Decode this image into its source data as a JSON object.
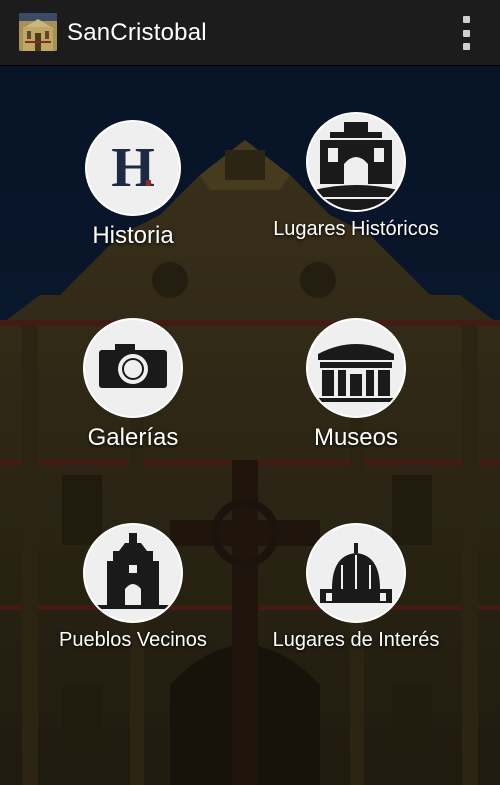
{
  "app_bar": {
    "title": "SanCristobal",
    "app_icon": "cathedral-thumbnail-icon",
    "overflow_icon": "more-vert-icon"
  },
  "menu": [
    {
      "label": "Historia",
      "icon": "letter-h-icon"
    },
    {
      "label": "Lugares Históricos",
      "icon": "historic-arch-icon"
    },
    {
      "label": "Galerías",
      "icon": "camera-icon"
    },
    {
      "label": "Museos",
      "icon": "museum-building-icon"
    },
    {
      "label": "Pueblos Vecinos",
      "icon": "village-church-icon"
    },
    {
      "label": "Lugares de Interés",
      "icon": "dome-icon"
    }
  ],
  "colors": {
    "app_bar": "#1c1c1c",
    "sky": "#0e2340",
    "facade": "#4a3e21",
    "icon_circle": "#efefef",
    "icon_glyph": "#1a1a1a",
    "letter_h": "#1e2a44",
    "accent_red": "#8a2d1e"
  }
}
